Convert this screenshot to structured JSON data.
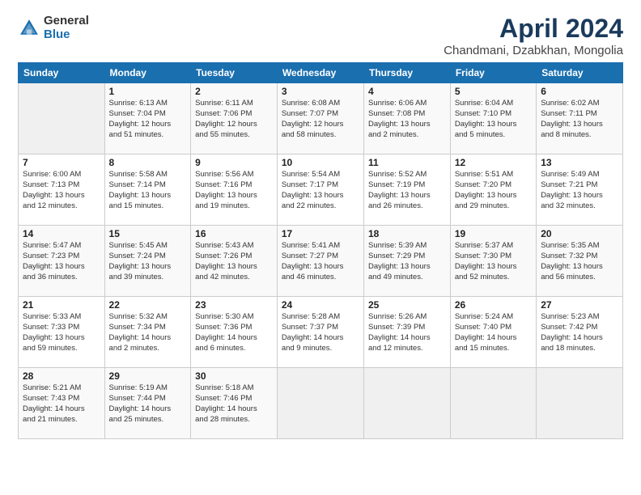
{
  "logo": {
    "general": "General",
    "blue": "Blue"
  },
  "title": "April 2024",
  "subtitle": "Chandmani, Dzabkhan, Mongolia",
  "weekdays": [
    "Sunday",
    "Monday",
    "Tuesday",
    "Wednesday",
    "Thursday",
    "Friday",
    "Saturday"
  ],
  "weeks": [
    [
      {
        "day": "",
        "info": ""
      },
      {
        "day": "1",
        "info": "Sunrise: 6:13 AM\nSunset: 7:04 PM\nDaylight: 12 hours\nand 51 minutes."
      },
      {
        "day": "2",
        "info": "Sunrise: 6:11 AM\nSunset: 7:06 PM\nDaylight: 12 hours\nand 55 minutes."
      },
      {
        "day": "3",
        "info": "Sunrise: 6:08 AM\nSunset: 7:07 PM\nDaylight: 12 hours\nand 58 minutes."
      },
      {
        "day": "4",
        "info": "Sunrise: 6:06 AM\nSunset: 7:08 PM\nDaylight: 13 hours\nand 2 minutes."
      },
      {
        "day": "5",
        "info": "Sunrise: 6:04 AM\nSunset: 7:10 PM\nDaylight: 13 hours\nand 5 minutes."
      },
      {
        "day": "6",
        "info": "Sunrise: 6:02 AM\nSunset: 7:11 PM\nDaylight: 13 hours\nand 8 minutes."
      }
    ],
    [
      {
        "day": "7",
        "info": "Sunrise: 6:00 AM\nSunset: 7:13 PM\nDaylight: 13 hours\nand 12 minutes."
      },
      {
        "day": "8",
        "info": "Sunrise: 5:58 AM\nSunset: 7:14 PM\nDaylight: 13 hours\nand 15 minutes."
      },
      {
        "day": "9",
        "info": "Sunrise: 5:56 AM\nSunset: 7:16 PM\nDaylight: 13 hours\nand 19 minutes."
      },
      {
        "day": "10",
        "info": "Sunrise: 5:54 AM\nSunset: 7:17 PM\nDaylight: 13 hours\nand 22 minutes."
      },
      {
        "day": "11",
        "info": "Sunrise: 5:52 AM\nSunset: 7:19 PM\nDaylight: 13 hours\nand 26 minutes."
      },
      {
        "day": "12",
        "info": "Sunrise: 5:51 AM\nSunset: 7:20 PM\nDaylight: 13 hours\nand 29 minutes."
      },
      {
        "day": "13",
        "info": "Sunrise: 5:49 AM\nSunset: 7:21 PM\nDaylight: 13 hours\nand 32 minutes."
      }
    ],
    [
      {
        "day": "14",
        "info": "Sunrise: 5:47 AM\nSunset: 7:23 PM\nDaylight: 13 hours\nand 36 minutes."
      },
      {
        "day": "15",
        "info": "Sunrise: 5:45 AM\nSunset: 7:24 PM\nDaylight: 13 hours\nand 39 minutes."
      },
      {
        "day": "16",
        "info": "Sunrise: 5:43 AM\nSunset: 7:26 PM\nDaylight: 13 hours\nand 42 minutes."
      },
      {
        "day": "17",
        "info": "Sunrise: 5:41 AM\nSunset: 7:27 PM\nDaylight: 13 hours\nand 46 minutes."
      },
      {
        "day": "18",
        "info": "Sunrise: 5:39 AM\nSunset: 7:29 PM\nDaylight: 13 hours\nand 49 minutes."
      },
      {
        "day": "19",
        "info": "Sunrise: 5:37 AM\nSunset: 7:30 PM\nDaylight: 13 hours\nand 52 minutes."
      },
      {
        "day": "20",
        "info": "Sunrise: 5:35 AM\nSunset: 7:32 PM\nDaylight: 13 hours\nand 56 minutes."
      }
    ],
    [
      {
        "day": "21",
        "info": "Sunrise: 5:33 AM\nSunset: 7:33 PM\nDaylight: 13 hours\nand 59 minutes."
      },
      {
        "day": "22",
        "info": "Sunrise: 5:32 AM\nSunset: 7:34 PM\nDaylight: 14 hours\nand 2 minutes."
      },
      {
        "day": "23",
        "info": "Sunrise: 5:30 AM\nSunset: 7:36 PM\nDaylight: 14 hours\nand 6 minutes."
      },
      {
        "day": "24",
        "info": "Sunrise: 5:28 AM\nSunset: 7:37 PM\nDaylight: 14 hours\nand 9 minutes."
      },
      {
        "day": "25",
        "info": "Sunrise: 5:26 AM\nSunset: 7:39 PM\nDaylight: 14 hours\nand 12 minutes."
      },
      {
        "day": "26",
        "info": "Sunrise: 5:24 AM\nSunset: 7:40 PM\nDaylight: 14 hours\nand 15 minutes."
      },
      {
        "day": "27",
        "info": "Sunrise: 5:23 AM\nSunset: 7:42 PM\nDaylight: 14 hours\nand 18 minutes."
      }
    ],
    [
      {
        "day": "28",
        "info": "Sunrise: 5:21 AM\nSunset: 7:43 PM\nDaylight: 14 hours\nand 21 minutes."
      },
      {
        "day": "29",
        "info": "Sunrise: 5:19 AM\nSunset: 7:44 PM\nDaylight: 14 hours\nand 25 minutes."
      },
      {
        "day": "30",
        "info": "Sunrise: 5:18 AM\nSunset: 7:46 PM\nDaylight: 14 hours\nand 28 minutes."
      },
      {
        "day": "",
        "info": ""
      },
      {
        "day": "",
        "info": ""
      },
      {
        "day": "",
        "info": ""
      },
      {
        "day": "",
        "info": ""
      }
    ]
  ]
}
